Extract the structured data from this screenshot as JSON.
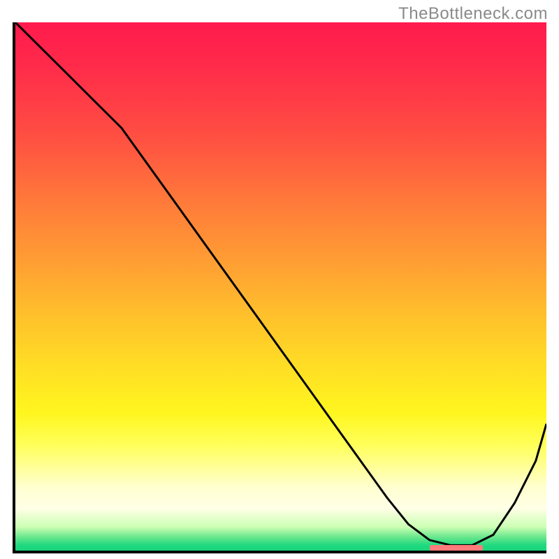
{
  "watermark": "TheBottleneck.com",
  "chart_data": {
    "type": "line",
    "title": "",
    "xlabel": "",
    "ylabel": "",
    "xlim": [
      0,
      100
    ],
    "ylim": [
      0,
      100
    ],
    "series": [
      {
        "name": "curve",
        "x": [
          0,
          5,
          10,
          15,
          20,
          25,
          30,
          35,
          40,
          45,
          50,
          55,
          60,
          65,
          70,
          74,
          78,
          82,
          86,
          90,
          94,
          98,
          100
        ],
        "y": [
          100,
          95,
          90,
          85,
          80,
          73,
          66,
          59,
          52,
          45,
          38,
          31,
          24,
          17,
          10,
          5,
          2,
          1,
          1,
          3,
          9,
          17,
          24
        ]
      }
    ],
    "optimal_range_x": [
      78,
      88
    ],
    "gradient": {
      "top_color": "#ff1a4d",
      "mid_color": "#ffe024",
      "bottom_color": "#19d47a"
    }
  }
}
